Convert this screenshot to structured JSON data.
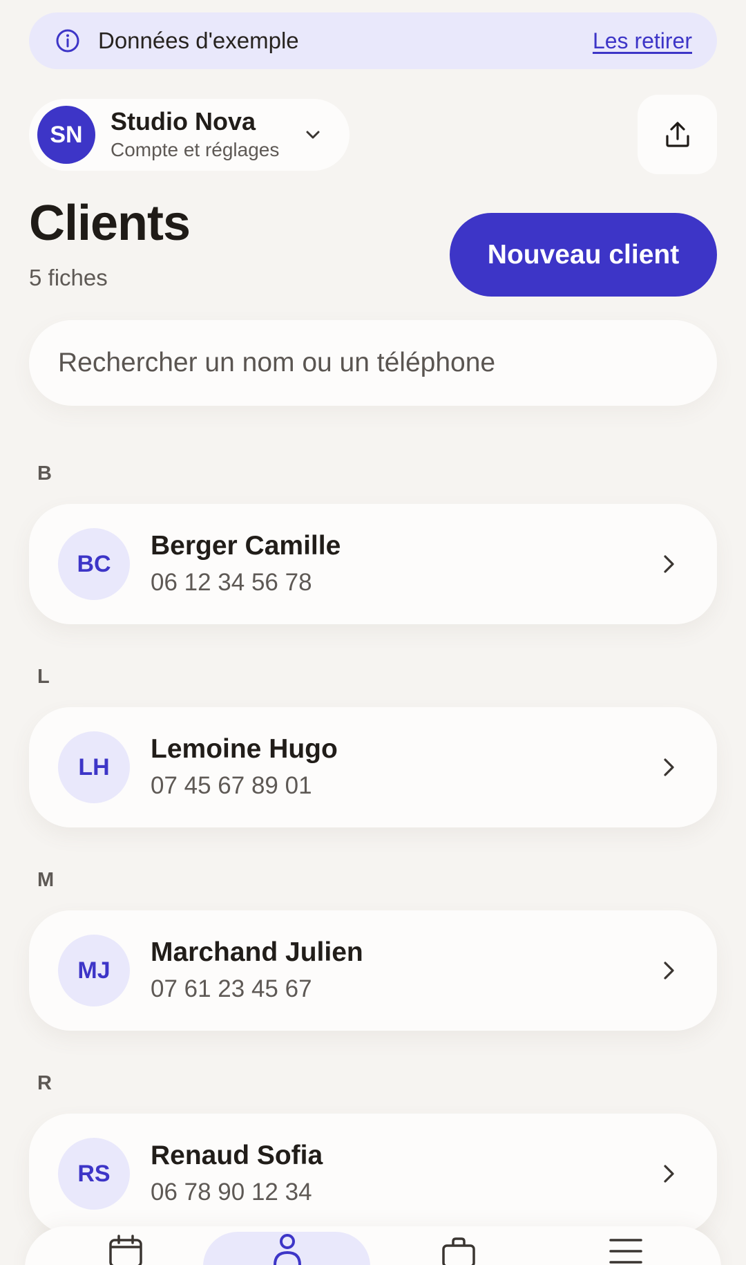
{
  "banner": {
    "text": "Données d'exemple",
    "link": "Les retirer"
  },
  "account": {
    "initials": "SN",
    "name": "Studio Nova",
    "subtitle": "Compte et réglages"
  },
  "header": {
    "title": "Clients",
    "count": "5 fiches",
    "new_button": "Nouveau client"
  },
  "search": {
    "placeholder": "Rechercher un nom ou un téléphone"
  },
  "sections": [
    {
      "letter": "B",
      "client": {
        "initials": "BC",
        "name": "Berger Camille",
        "phone": "06 12 34 56 78"
      }
    },
    {
      "letter": "L",
      "client": {
        "initials": "LH",
        "name": "Lemoine Hugo",
        "phone": "07 45 67 89 01"
      }
    },
    {
      "letter": "M",
      "client": {
        "initials": "MJ",
        "name": "Marchand Julien",
        "phone": "07 61 23 45 67"
      }
    },
    {
      "letter": "R",
      "client": {
        "initials": "RS",
        "name": "Renaud Sofia",
        "phone": "06 78 90 12 34"
      }
    }
  ],
  "nav": {
    "items": [
      "calendar-icon",
      "person-icon",
      "briefcase-icon",
      "menu-icon"
    ],
    "active": "person-icon"
  },
  "colors": {
    "accent": "#3d35c7",
    "accent_soft": "#e9e8fb",
    "background": "#f6f4f1",
    "card": "#fdfcfb"
  }
}
